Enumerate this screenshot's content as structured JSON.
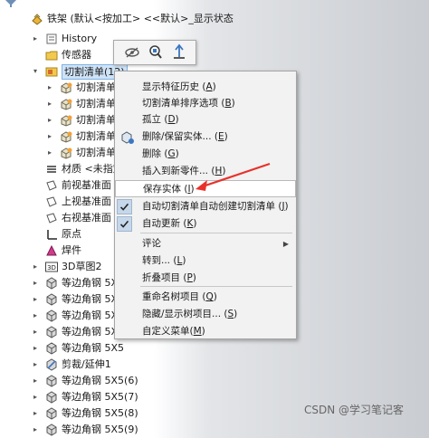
{
  "tree": {
    "root_label": "铁架 (默认<按加工> <<默认>_显示状态",
    "items": [
      {
        "label": "History",
        "icon": "history-icon",
        "expander": "▸"
      },
      {
        "label": "传感器",
        "icon": "sensor-folder-icon",
        "expander": ""
      },
      {
        "label": "切割清单(12)",
        "icon": "cut-list-icon",
        "expander": "▾",
        "selected": true
      },
      {
        "label": "切割清单",
        "icon": "cut-list-item-icon",
        "expander": "▸"
      },
      {
        "label": "切割清单",
        "icon": "cut-list-item-icon",
        "expander": "▸"
      },
      {
        "label": "切割清单",
        "icon": "cut-list-item-icon",
        "expander": "▸"
      },
      {
        "label": "切割清单",
        "icon": "cut-list-item-icon",
        "expander": "▸"
      },
      {
        "label": "切割清单",
        "icon": "cut-list-item-icon",
        "expander": "▸"
      },
      {
        "label": "材质 <未指定",
        "icon": "material-icon",
        "expander": ""
      },
      {
        "label": "前视基准面",
        "icon": "plane-icon",
        "expander": ""
      },
      {
        "label": "上视基准面",
        "icon": "plane-icon",
        "expander": ""
      },
      {
        "label": "右视基准面",
        "icon": "plane-icon",
        "expander": ""
      },
      {
        "label": "原点",
        "icon": "origin-icon",
        "expander": ""
      },
      {
        "label": "焊件",
        "icon": "weldment-icon",
        "expander": ""
      },
      {
        "label": "3D草图2",
        "icon": "sketch-3d-icon",
        "expander": "▸"
      },
      {
        "label": "等边角钢 5X5",
        "icon": "angle-steel-icon",
        "expander": "▸"
      },
      {
        "label": "等边角钢 5X5",
        "icon": "angle-steel-icon",
        "expander": "▸"
      },
      {
        "label": "等边角钢 5X5",
        "icon": "angle-steel-icon",
        "expander": "▸"
      },
      {
        "label": "等边角钢 5X5",
        "icon": "angle-steel-icon",
        "expander": "▸"
      },
      {
        "label": "等边角钢 5X5",
        "icon": "angle-steel-icon",
        "expander": "▸"
      },
      {
        "label": "剪裁/延伸1",
        "icon": "trim-extend-icon",
        "expander": "▸"
      },
      {
        "label": "等边角钢 5X5(6)",
        "icon": "angle-steel-icon",
        "expander": "▸"
      },
      {
        "label": "等边角钢 5X5(7)",
        "icon": "angle-steel-icon",
        "expander": "▸"
      },
      {
        "label": "等边角钢 5X5(8)",
        "icon": "angle-steel-icon",
        "expander": "▸"
      },
      {
        "label": "等边角钢 5X5(9)",
        "icon": "angle-steel-icon",
        "expander": "▸"
      }
    ]
  },
  "toolbar": {
    "buttons": [
      "hide-show-icon",
      "zoom-to-selection-icon",
      "normal-to-icon"
    ]
  },
  "menu": {
    "items": [
      {
        "text": "显示特征历史 (",
        "key": "A",
        "end": ")"
      },
      {
        "text": "切割清单排序选项 (",
        "key": "B",
        "end": ")"
      },
      {
        "text": "孤立 (",
        "key": "D",
        "end": ")"
      },
      {
        "text": "删除/保留实体... (",
        "key": "E",
        "end": ")",
        "icon": "delete-keep-body-icon"
      },
      {
        "text": "删除 (",
        "key": "G",
        "end": ")"
      },
      {
        "text": "插入到新零件... (",
        "key": "H",
        "end": ")"
      },
      {
        "text": "保存实体 (",
        "key": "I",
        "end": ")",
        "highlight": true
      },
      {
        "text": "自动切割清单自动创建切割清单 (",
        "key": "J",
        "end": ")",
        "checked": true
      },
      {
        "text": "自动更新 (",
        "key": "K",
        "end": ")",
        "checked": true
      },
      {
        "text": "评论",
        "key": "",
        "end": "",
        "submenu": true
      },
      {
        "text": "转到... (",
        "key": "L",
        "end": ")"
      },
      {
        "text": "折叠项目 (",
        "key": "P",
        "end": ")"
      },
      {
        "text": "重命名树项目 (",
        "key": "Q",
        "end": ")"
      },
      {
        "text": "隐藏/显示树项目... (",
        "key": "S",
        "end": ")"
      },
      {
        "text": "自定义菜单(",
        "key": "M",
        "end": ")"
      }
    ]
  },
  "watermark": "CSDN @学习笔记客",
  "colors": {
    "selection": "#cfe3f7",
    "arrow": "#e8312a",
    "check_bg": "#c6d7ea"
  }
}
